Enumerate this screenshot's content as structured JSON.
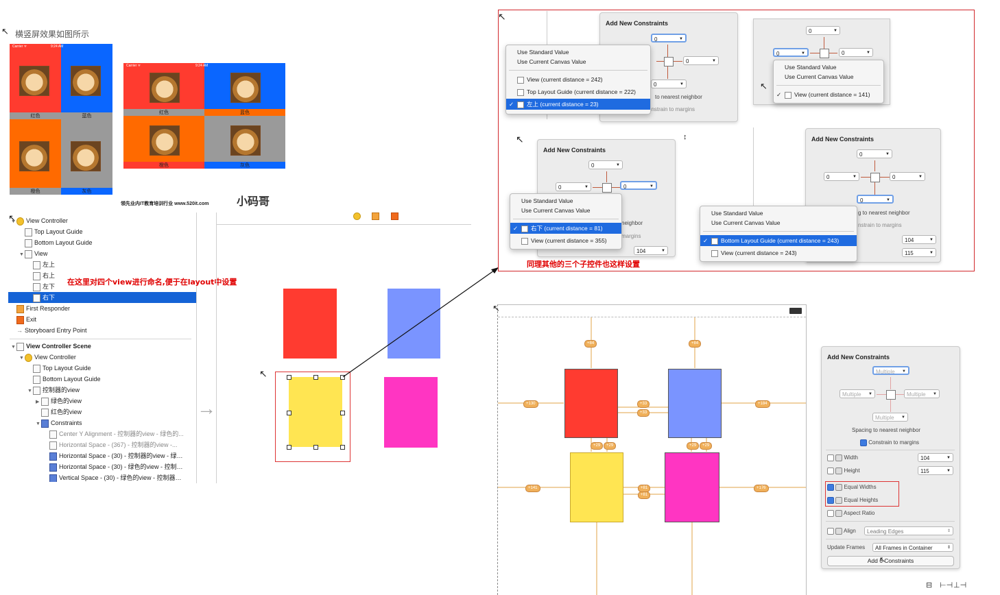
{
  "caption_top": "横竖屏效果如图所示",
  "colors": {
    "red": "#ff3b2f",
    "blue": "#0a66ff",
    "orange": "#ff6a00",
    "gray": "#9a9a9a",
    "sel_blue": "#1563d6",
    "annotation_red": "#e00000"
  },
  "portrait": {
    "status_left": "Carrier ᯤ",
    "status_time": "9:24 AM",
    "labels": [
      "红色",
      "蓝色",
      "橙色",
      "灰色"
    ]
  },
  "landscape": {
    "status_left": "Carrier ᯤ",
    "status_time": "9:24 AM",
    "labels": [
      "红色",
      "蓝色",
      "橙色",
      "灰色"
    ]
  },
  "watermark": {
    "text": "领先业内IT教育培训行业 www.520it.com",
    "logo": "小码哥"
  },
  "outline_top": [
    {
      "label": "View Controller",
      "icon": "vc",
      "indent": 0,
      "tri": "▼"
    },
    {
      "label": "Top Layout Guide",
      "icon": "box",
      "indent": 1,
      "tri": ""
    },
    {
      "label": "Bottom Layout Guide",
      "icon": "box",
      "indent": 1,
      "tri": ""
    },
    {
      "label": "View",
      "icon": "box",
      "indent": 1,
      "tri": "▼"
    },
    {
      "label": "左上",
      "icon": "box",
      "indent": 2,
      "tri": ""
    },
    {
      "label": "右上",
      "icon": "box",
      "indent": 2,
      "tri": ""
    },
    {
      "label": "左下",
      "icon": "box",
      "indent": 2,
      "tri": ""
    },
    {
      "label": "右下",
      "icon": "box",
      "indent": 2,
      "tri": "",
      "selected": true
    },
    {
      "label": "First Responder",
      "icon": "fr",
      "indent": 0,
      "tri": ""
    },
    {
      "label": "Exit",
      "icon": "ex",
      "indent": 0,
      "tri": ""
    },
    {
      "label": "Storyboard Entry Point",
      "icon": "arrow",
      "indent": 0,
      "tri": ""
    }
  ],
  "outline_note": "在这里对四个view进行命名,便于在layout中设置",
  "outline_bottom": [
    {
      "label": "View Controller Scene",
      "icon": "box",
      "indent": 0,
      "tri": "▼",
      "bold": true
    },
    {
      "label": "View Controller",
      "icon": "vc",
      "indent": 1,
      "tri": "▼"
    },
    {
      "label": "Top Layout Guide",
      "icon": "box",
      "indent": 2,
      "tri": ""
    },
    {
      "label": "Bottom Layout Guide",
      "icon": "box",
      "indent": 2,
      "tri": ""
    },
    {
      "label": "控制器的view",
      "icon": "box",
      "indent": 2,
      "tri": "▼"
    },
    {
      "label": "绿色的view",
      "icon": "box",
      "indent": 3,
      "tri": "▶"
    },
    {
      "label": "红色的view",
      "icon": "box",
      "indent": 3,
      "tri": ""
    },
    {
      "label": "Constraints",
      "icon": "cn",
      "indent": 3,
      "tri": "▼"
    },
    {
      "label": "Center Y Alignment - 控制器的view - 绿色的...",
      "icon": "box",
      "indent": 4,
      "tri": "",
      "dim": true
    },
    {
      "label": "Horizontal Space - (367) - 控制器的view -...",
      "icon": "box",
      "indent": 4,
      "tri": "",
      "dim": true
    },
    {
      "label": "Horizontal Space - (30) - 控制器的view - 绿…",
      "icon": "cn",
      "indent": 4,
      "tri": ""
    },
    {
      "label": "Horizontal Space - (30) - 绿色的view - 控制…",
      "icon": "cn",
      "indent": 4,
      "tri": ""
    },
    {
      "label": "Vertical Space - (30) - 绿色的view - 控制器…",
      "icon": "cn",
      "indent": 4,
      "tri": ""
    }
  ],
  "canvas_colors": {
    "red": "#ff3b30",
    "blue": "#7a94ff",
    "yellow": "#ffe552",
    "magenta": "#ff35c2"
  },
  "red_box_note": "同理其他的三个子控件也这样设置",
  "panelA": {
    "title": "Add New Constraints",
    "top": "0",
    "left": "0",
    "right": "0",
    "bottom": "0",
    "menu": [
      "Use Standard Value",
      "Use Current Canvas Value",
      "View (current distance = 242)",
      "Top Layout Guide (current distance = 222)",
      "左上 (current distance = 23)"
    ],
    "frag1": "to nearest neighbor",
    "frag2": "onstrain to margins"
  },
  "panelB": {
    "top": "0",
    "left": "0",
    "right": "0",
    "menu": [
      "Use Standard Value",
      "Use Current Canvas Value",
      "View (current distance = 141)"
    ]
  },
  "panelC": {
    "title": "Add New Constraints",
    "top": "0",
    "left": "0",
    "right": "0",
    "menu": [
      "Use Standard Value",
      "Use Current Canvas Value",
      "右下 (current distance = 81)",
      "View (current distance = 355)"
    ],
    "frag1": "neighbor",
    "frag2": "margins",
    "frag3": "104"
  },
  "panelD": {
    "title": "Add New Constraints",
    "top": "0",
    "left": "0",
    "right": "0",
    "bottom": "0",
    "menu": [
      "Use Standard Value",
      "Use Current Canvas Value",
      "Bottom Layout Guide (current distance = 243)",
      "View (current distance = 243)"
    ],
    "frag1": "g to nearest neighbor",
    "frag2": "nstrain to margins",
    "width": "104",
    "height": "115"
  },
  "badges": {
    "top": "+84",
    "left": "+130",
    "right": "+184",
    "mid_h": "+33",
    "mid_v": "+29",
    "bleft": "+141",
    "bright": "+176",
    "bmid": "+81"
  },
  "panelE": {
    "title": "Add New Constraints",
    "top": "Multiple",
    "left": "Multiple",
    "right": "Multiple",
    "bottom": "Multiple",
    "spacing": "Spacing to nearest neighbor",
    "constrain": "Constrain to margins",
    "width_label": "Width",
    "width_val": "104",
    "height_label": "Height",
    "height_val": "115",
    "equal_widths": "Equal Widths",
    "equal_heights": "Equal Heights",
    "aspect": "Aspect Ratio",
    "align_label": "Align",
    "align_val": "Leading Edges",
    "update_label": "Update Frames",
    "update_val": "All Frames in Container",
    "add_btn": "Add 6 Constraints"
  }
}
